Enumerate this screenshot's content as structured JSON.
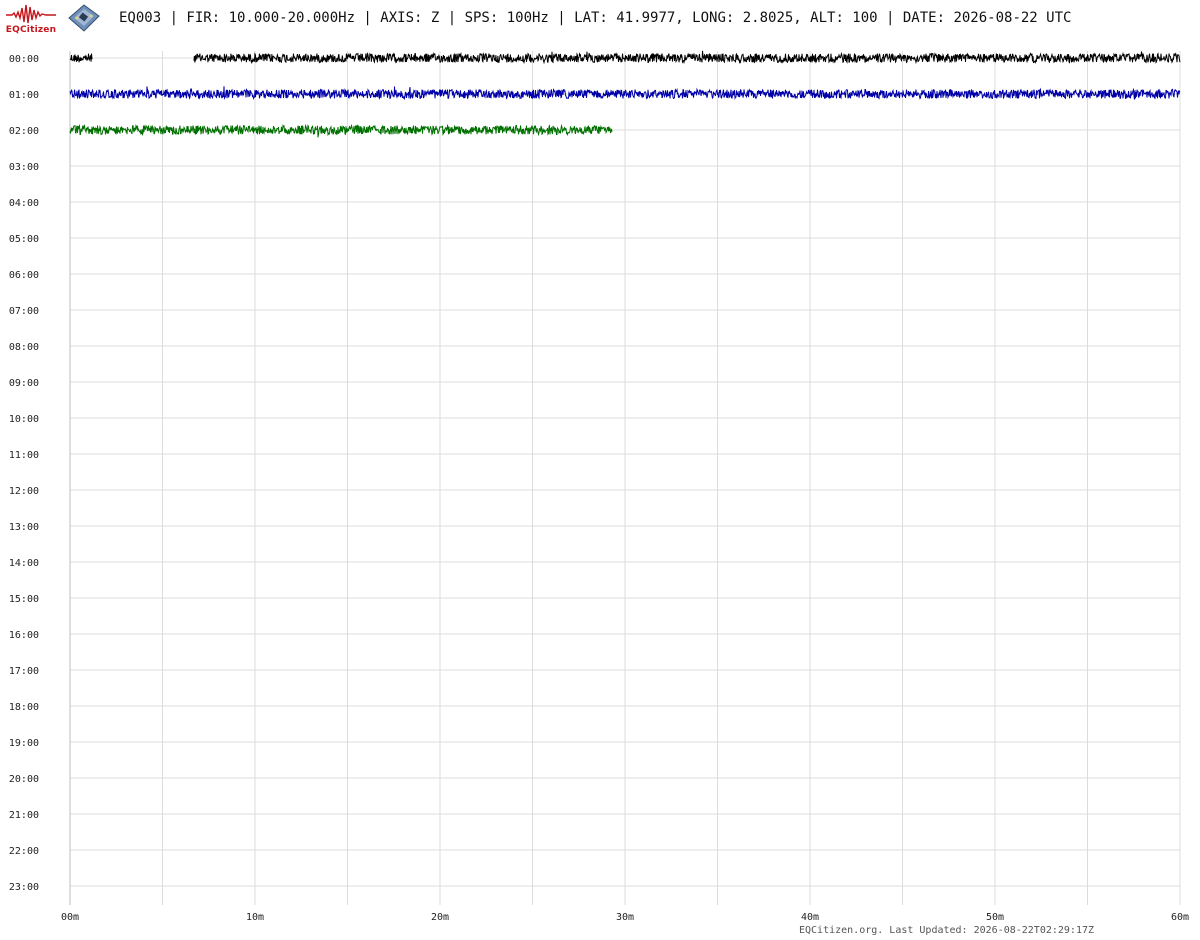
{
  "header": {
    "logo_text": "EQCitizen",
    "title": "EQ003 | FIR: 10.000-20.000Hz | AXIS: Z | SPS: 100Hz | LAT: 41.9977, LONG: 2.8025, ALT: 100 | DATE: 2026-08-22 UTC"
  },
  "icons": [
    "seismogram-logo-icon",
    "sensor-board-icon"
  ],
  "chart_data": {
    "type": "line",
    "title": "",
    "xlabel": "",
    "ylabel": "",
    "x_ticks": [
      "00m",
      "10m",
      "20m",
      "30m",
      "40m",
      "50m",
      "60m"
    ],
    "x_range_minutes": [
      0,
      60
    ],
    "x_grid_step_minutes": 5,
    "y_ticks": [
      "00:00",
      "01:00",
      "02:00",
      "03:00",
      "04:00",
      "05:00",
      "06:00",
      "07:00",
      "08:00",
      "09:00",
      "10:00",
      "11:00",
      "12:00",
      "13:00",
      "14:00",
      "15:00",
      "16:00",
      "17:00",
      "18:00",
      "19:00",
      "20:00",
      "21:00",
      "22:00",
      "23:00"
    ],
    "grid": true,
    "series": [
      {
        "row": "00:00",
        "color": "#000000",
        "segments": [
          [
            0.0,
            1.2
          ],
          [
            6.7,
            60.0
          ]
        ]
      },
      {
        "row": "01:00",
        "color": "#0000aa",
        "segments": [
          [
            0.0,
            60.0
          ]
        ]
      },
      {
        "row": "02:00",
        "color": "#007000",
        "segments": [
          [
            0.0,
            29.3
          ]
        ]
      }
    ]
  },
  "footer": {
    "text": "EQCitizen.org. Last Updated: 2026-08-22T02:29:17Z"
  }
}
